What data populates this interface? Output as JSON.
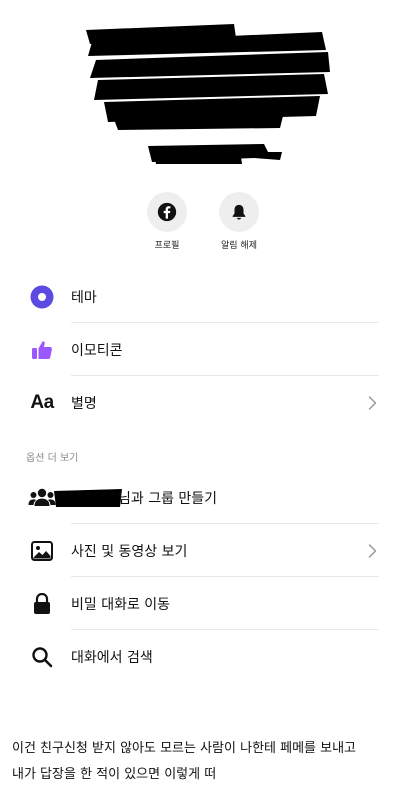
{
  "actions": {
    "profile_label": "프로필",
    "notify_label": "알림 해제"
  },
  "settings": {
    "items": [
      {
        "label": "테마",
        "icon": "theme-circle-icon",
        "chevron": false
      },
      {
        "label": "이모티콘",
        "icon": "thumbs-up-icon",
        "chevron": false
      },
      {
        "label": "별명",
        "icon": "font-aa-icon",
        "icon_text": "Aa",
        "chevron": true
      }
    ]
  },
  "more_options": {
    "header": "옵션 더 보기",
    "items": [
      {
        "label": "님과 그룹 만들기",
        "icon": "people-group-icon",
        "chevron": false,
        "redacted_prefix": true
      },
      {
        "label": "사진 및 동영상 보기",
        "icon": "photo-icon",
        "chevron": true
      },
      {
        "label": "비밀 대화로 이동",
        "icon": "lock-icon",
        "chevron": false
      },
      {
        "label": "대화에서 검색",
        "icon": "search-icon",
        "chevron": false
      }
    ]
  },
  "caption": {
    "line1": "이건 친구신청 받지 않아도 모르는 사람이 나한테 페메를 보내고",
    "line2": "내가 답장을 한 적이 있으면 이렇게 떠"
  },
  "colors": {
    "theme_purple": "#5b4be0",
    "emoji_purple": "#9c58ff",
    "icon_bg": "#eeeeee",
    "redaction": "#000000"
  }
}
